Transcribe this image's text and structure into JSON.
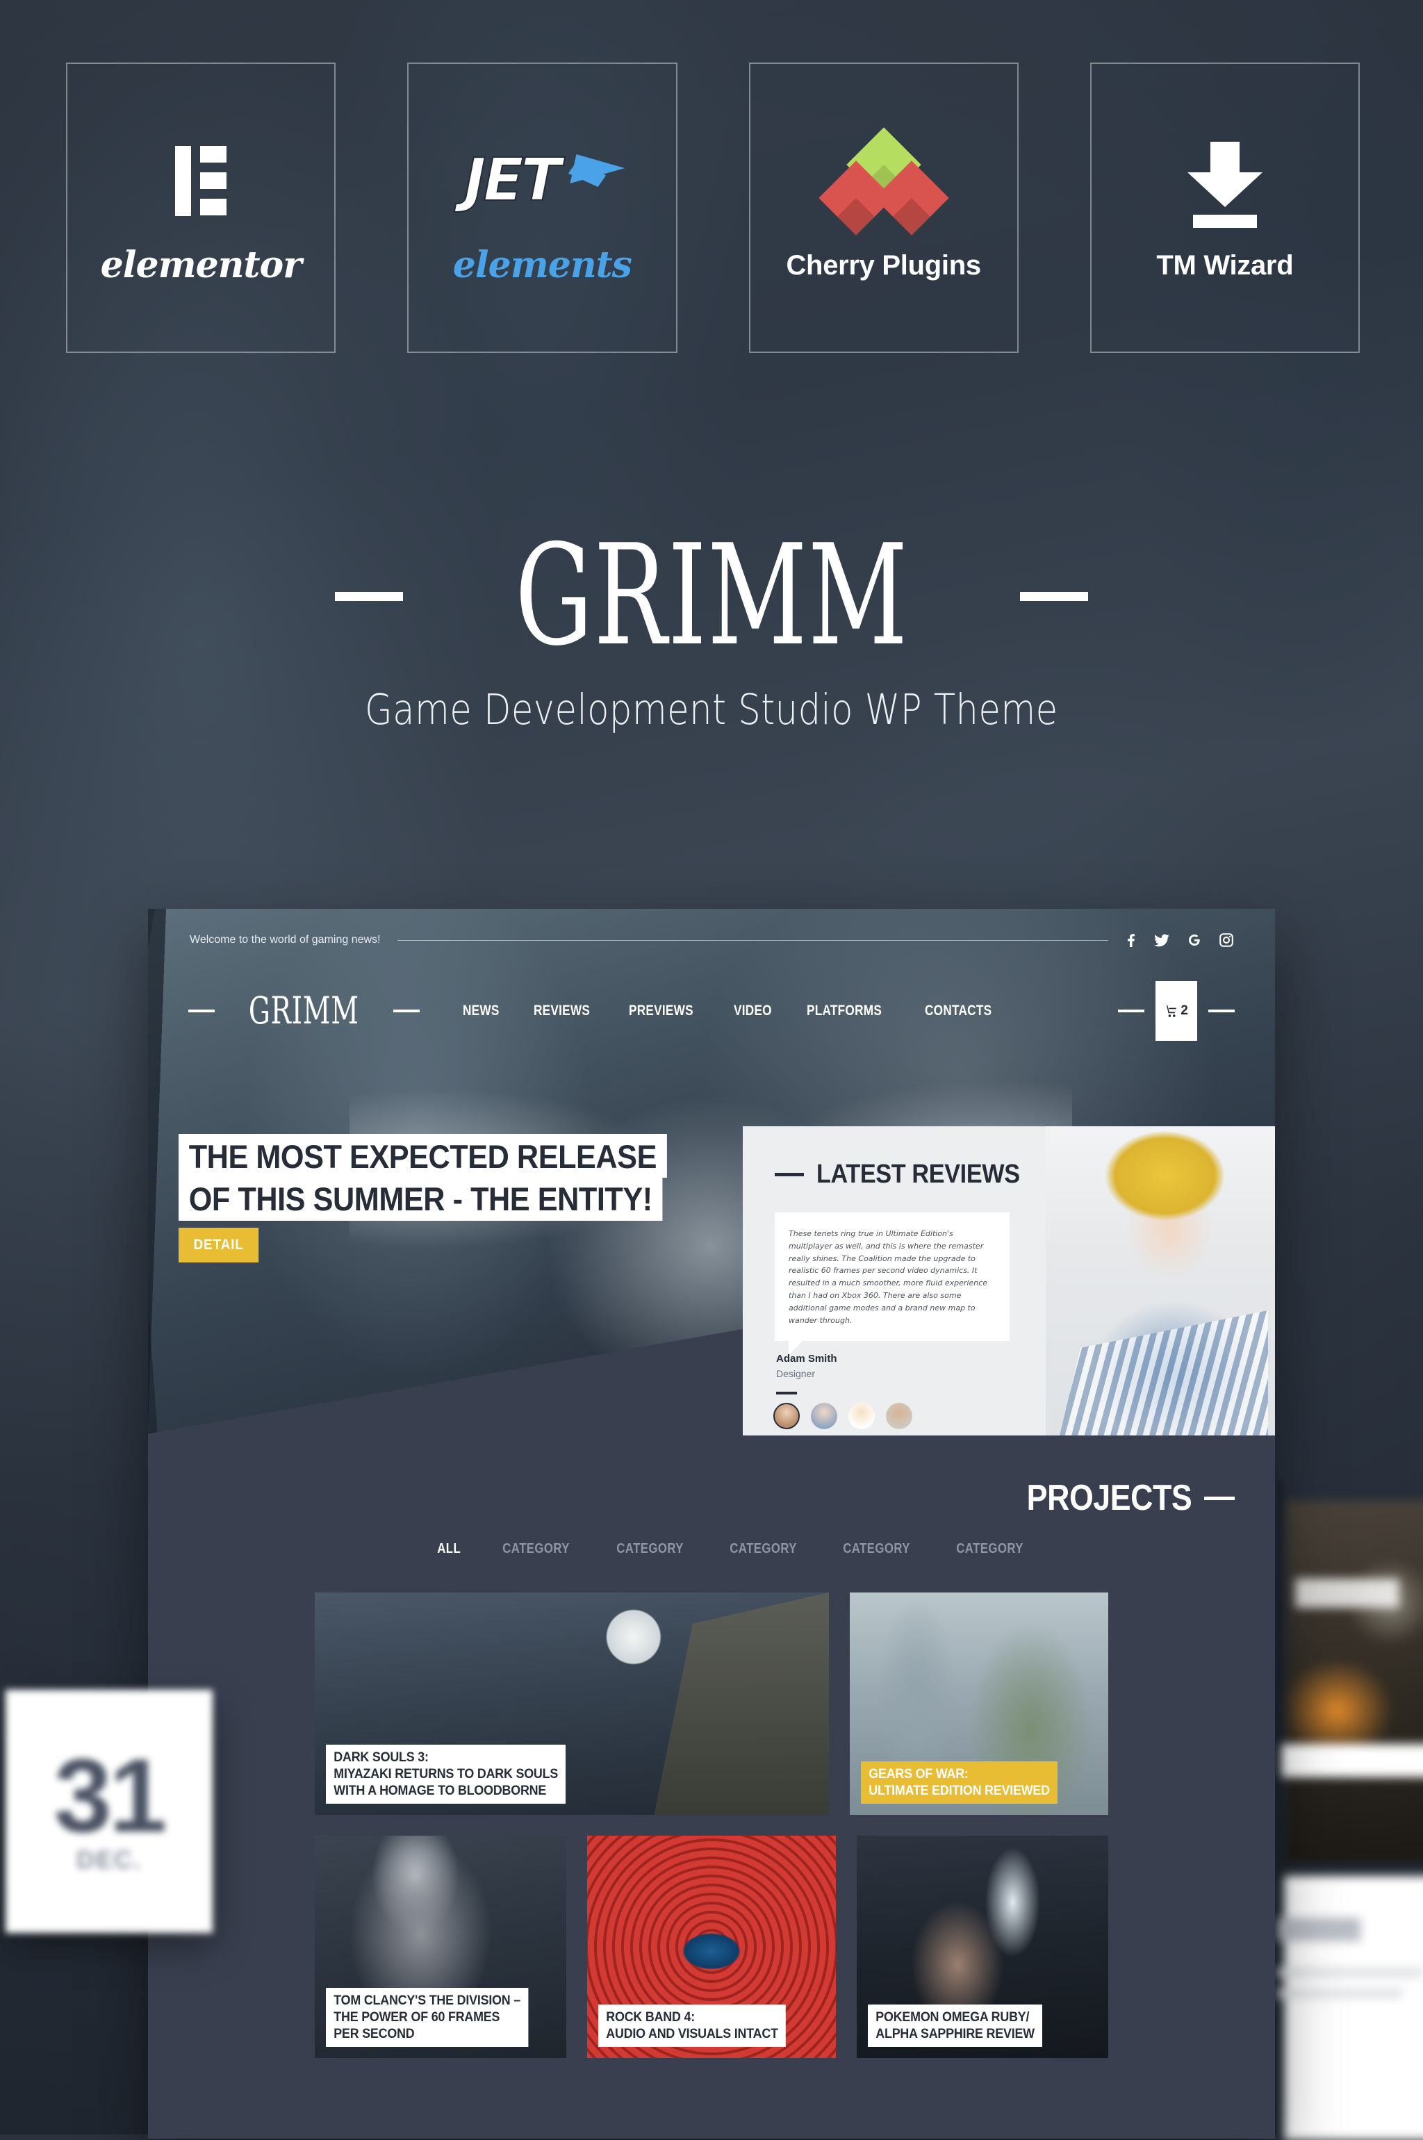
{
  "theme": {
    "accent_yellow": "#e8bd34",
    "dark_navy": "#262c38",
    "panel_bg": "#393f4f",
    "jet_blue": "#4aa3e8",
    "cherry_green": "#b5dd5f",
    "cherry_red": "#d9544f"
  },
  "badges": [
    {
      "label": "elementor",
      "icon": "elementor-logo-icon"
    },
    {
      "label": "elements",
      "wordmark": "JET",
      "icon": "jet-elements-logo-icon"
    },
    {
      "label": "Cherry Plugins",
      "icon": "cherry-plugins-diamond-icon"
    },
    {
      "label": "TM Wizard",
      "icon": "download-arrow-icon"
    }
  ],
  "hero": {
    "title": "GRIMM",
    "subtitle": "Game Development Studio WP Theme"
  },
  "mockup": {
    "topbar": {
      "welcome": "Welcome to the world of gaming news!",
      "social": [
        "facebook-icon",
        "twitter-icon",
        "google-icon",
        "instagram-icon"
      ]
    },
    "nav": {
      "logo": "GRIMM",
      "menu": [
        "NEWS",
        "REVIEWS",
        "PREVIEWS",
        "VIDEO",
        "PLATFORMS",
        "CONTACTS"
      ],
      "cart_icon": "shopping-cart-icon",
      "cart_count": "2"
    },
    "headline": {
      "line1": "THE MOST EXPECTED RELEASE",
      "line2": "OF THIS SUMMER - THE ENTITY!",
      "cta": "DETAIL"
    },
    "reviews": {
      "title": "LATEST REVIEWS",
      "quote": "These tenets ring true in Ultimate Edition's multiplayer as well, and this is where the remaster really shines. The Coalition made the upgrade to realistic 60 frames per second video dynamics. It resulted in a much smoother, more fluid experience than I had on Xbox 360. There are also some additional game modes and a brand new map to wander through.",
      "author_name": "Adam Smith",
      "author_role": "Designer",
      "avatars": [
        "avatar-woman-glasses",
        "avatar-woman-brunette",
        "avatar-man-blond",
        "avatar-man-beard"
      ]
    },
    "projects": {
      "title": "PROJECTS",
      "filters": [
        "ALL",
        "CATEGORY",
        "CATEGORY",
        "CATEGORY",
        "CATEGORY",
        "CATEGORY"
      ],
      "active_filter": "ALL",
      "cards": [
        {
          "lines": [
            "DARK SOULS 3:",
            "MIYAZAKI RETURNS TO DARK SOULS",
            "WITH A HOMAGE TO BLOODBORNE"
          ],
          "style": "white"
        },
        {
          "lines": [
            "GEARS OF WAR:",
            "ULTIMATE EDITION REVIEWED"
          ],
          "style": "yellow"
        },
        {
          "lines": [
            "TOM CLANCY'S THE DIVISION –",
            "THE POWER OF 60 FRAMES",
            "PER SECOND"
          ],
          "style": "white"
        },
        {
          "lines": [
            "ROCK BAND 4:",
            "AUDIO AND VISUALS INTACT"
          ],
          "style": "white"
        },
        {
          "lines": [
            "POKEMON OMEGA RUBY/",
            "ALPHA SAPPHIRE REVIEW"
          ],
          "style": "white"
        }
      ]
    }
  },
  "date_badge": {
    "day": "31",
    "month": "DEC."
  }
}
